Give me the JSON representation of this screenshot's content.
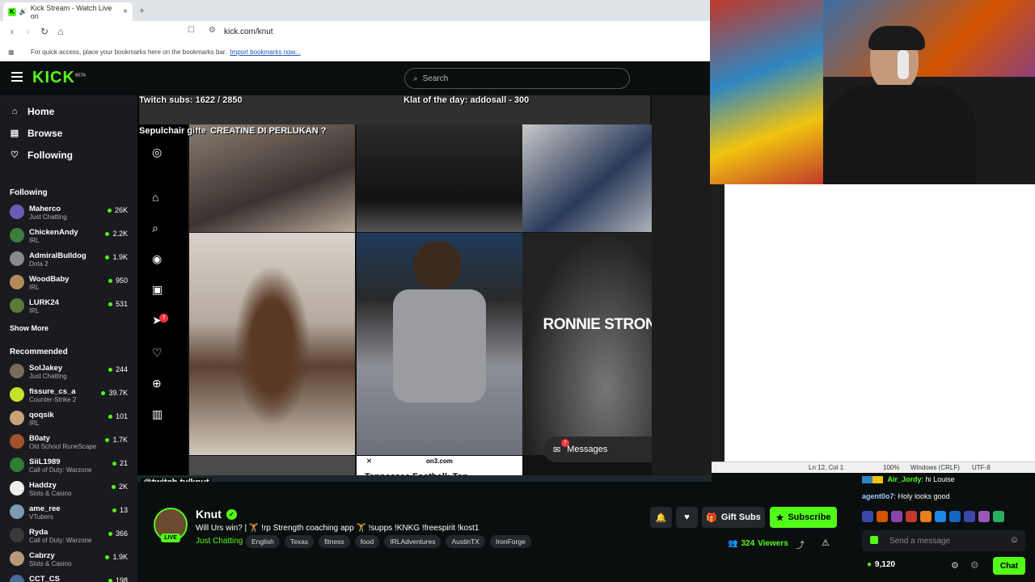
{
  "browser": {
    "tab_title": "Kick Stream - Watch Live on",
    "tab_close": "×",
    "new_tab": "+",
    "url": "kick.com/knut",
    "bookmarks_prompt": "For quick access, place your bookmarks here on the bookmarks bar.",
    "import_link": "Import bookmarks now..."
  },
  "header": {
    "logo": "KICK",
    "logo_beta": "BETA",
    "search_placeholder": "Search"
  },
  "sidebar": {
    "nav": [
      {
        "label": "Home",
        "icon": "home-icon"
      },
      {
        "label": "Browse",
        "icon": "browse-icon"
      },
      {
        "label": "Following",
        "icon": "heart-icon"
      }
    ],
    "following_heading": "Following",
    "following": [
      {
        "name": "Maherco",
        "category": "Just Chatting",
        "viewers": "26K",
        "color": "#6b5bb5"
      },
      {
        "name": "ChickenAndy",
        "category": "IRL",
        "viewers": "2.2K",
        "color": "#3b7d3a"
      },
      {
        "name": "AdmiralBulldog",
        "category": "Dota 2",
        "viewers": "1.9K",
        "color": "#8a8a8a"
      },
      {
        "name": "WoodBaby",
        "category": "IRL",
        "viewers": "950",
        "color": "#b58a5b"
      },
      {
        "name": "LURK24",
        "category": "IRL",
        "viewers": "531",
        "color": "#5b7b3a"
      }
    ],
    "show_more": "Show More",
    "recommended_heading": "Recommended",
    "recommended": [
      {
        "name": "SolJakey",
        "category": "Just Chatting",
        "viewers": "244",
        "color": "#7a6a5a"
      },
      {
        "name": "fissure_cs_a",
        "category": "Counter-Strike 2",
        "viewers": "39.7K",
        "color": "#c8e02a"
      },
      {
        "name": "qoqsik",
        "category": "IRL",
        "viewers": "101",
        "color": "#c9a27a"
      },
      {
        "name": "B0aty",
        "category": "Old School RuneScape",
        "viewers": "1.7K",
        "color": "#a0522d"
      },
      {
        "name": "SiiL1989",
        "category": "Call of Duty: Warzone",
        "viewers": "21",
        "color": "#2e7d32"
      },
      {
        "name": "Haddzy",
        "category": "Slots & Casino",
        "viewers": "2K",
        "color": "#eeeeee"
      },
      {
        "name": "ame_ree",
        "category": "VTubers",
        "viewers": "13",
        "color": "#7d9bb5"
      },
      {
        "name": "Ryda",
        "category": "Call of Duty: Warzone",
        "viewers": "366",
        "color": "#3a3a3a"
      },
      {
        "name": "Cabrzy",
        "category": "Slots & Casino",
        "viewers": "1.9K",
        "color": "#b59b7a"
      },
      {
        "name": "CCT_CS",
        "category": "",
        "viewers": "198",
        "color": "#4a6a9a"
      }
    ]
  },
  "stream": {
    "overlay_subs": "Twitch subs: 1622 / 2850",
    "overlay_klat": "Klat of the day: addosall - 300",
    "overlay_gift": "Sepulchair gifte",
    "caption_malay": "CREATINE DI PERLUKAN ?",
    "ronnie": "RONNIE STRONG",
    "messages_label": "Messages",
    "messages_badge": "7",
    "notif_badge": "7",
    "on3": "on3.com",
    "article": "Tennessee Football: Top",
    "twitch_tag": "@twitch.tv/knut",
    "close_x": "×"
  },
  "editor": {
    "position": "Ln 12, Col 1",
    "zoom": "100%",
    "eol": "Windows (CRLF)",
    "encoding": "UTF-8"
  },
  "channel": {
    "name": "Knut",
    "live": "LIVE",
    "title": "Will Urs win? | 🏋️ !rp Strength coaching app 🏋️ !supps !KNKG !freespirit !kost1",
    "category": "Just Chatting",
    "tags": [
      "English",
      "Texas",
      "fitness",
      "food",
      "IRLAdventures",
      "AustinTX",
      "IronForge"
    ],
    "gift_subs": "Gift Subs",
    "subscribe": "Subscribe",
    "viewers": "324",
    "viewers_label": "Viewers"
  },
  "chat": {
    "messages": [
      {
        "user": "Air_Jordy",
        "text": "hi Louise",
        "color": "#53fc18"
      },
      {
        "user": "agent0o7",
        "text": "Holy looks good",
        "color": "#9ecbff"
      }
    ],
    "input_placeholder": "Send a message",
    "points": "9,120",
    "chat_button": "Chat"
  }
}
